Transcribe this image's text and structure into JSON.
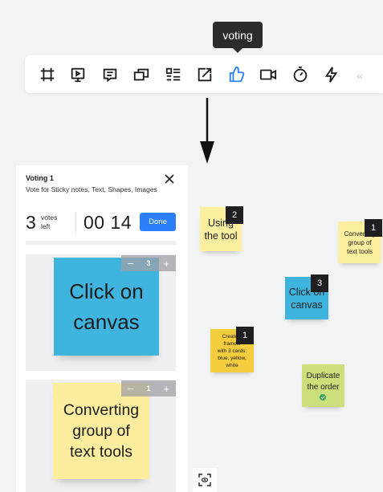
{
  "tooltip": {
    "label": "voting"
  },
  "toolbar": {
    "tools": [
      "frame-icon",
      "presentation-icon",
      "comment-icon",
      "cards-icon",
      "list-icon",
      "export-icon",
      "thumbs-up-icon",
      "video-icon",
      "timer-icon",
      "lightning-icon"
    ],
    "active_tool": "thumbs-up-icon",
    "collapse_label": "«"
  },
  "panel": {
    "title": "Voting 1",
    "subtitle": "Vote for Sticky notes, Text, Shapes, Images",
    "votes_count": "3",
    "votes_label_1": "votes",
    "votes_label_2": "left",
    "timer": "00 14",
    "done_label": "Done",
    "cards": [
      {
        "text_1": "Click on",
        "text_2": "canvas",
        "color": "#3fb4df",
        "minus": "−",
        "count": "3",
        "plus": "+"
      },
      {
        "text_1": "Converting",
        "text_2": "group of",
        "text_3": "text tools",
        "color": "#fcee9e",
        "minus": "−",
        "count": "1",
        "plus": "+"
      }
    ]
  },
  "canvas": {
    "notes": [
      {
        "id": "using-the-tool",
        "line1": "Using",
        "line2": "the tool",
        "votes": "2",
        "color": "#fcf0a0"
      },
      {
        "id": "converting",
        "line1": "Converting",
        "line2": "group of",
        "line3": "text tools",
        "votes": "1",
        "color": "#fcf0a0"
      },
      {
        "id": "click-canvas",
        "line1": "Click on",
        "line2": "canvas",
        "votes": "3",
        "color": "#3fb4df"
      },
      {
        "id": "create-frameworks",
        "line1": "Create e",
        "line2": "framew",
        "line3": "with 3 cards:",
        "line4": "blue, yellow,",
        "line5": "white",
        "votes": "1",
        "color": "#f4cd3e"
      },
      {
        "id": "duplicate-order",
        "line1": "Duplicate",
        "line2": "the order",
        "color": "#cbe07a"
      }
    ]
  }
}
